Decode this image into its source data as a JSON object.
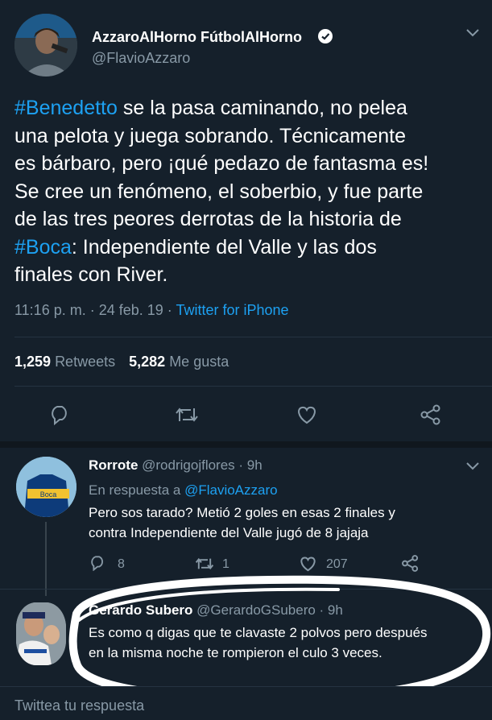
{
  "main_tweet": {
    "display_name": "AzzaroAlHorno FútbolAlHorno",
    "handle": "@FlavioAzzaro",
    "text_lines": [
      [
        {
          "t": "#Benedetto",
          "hl": true
        },
        {
          "t": " se la pasa caminando, no pelea",
          "hl": false
        }
      ],
      [
        {
          "t": "una pelota y juega sobrando. Técnicamente",
          "hl": false
        }
      ],
      [
        {
          "t": "es bárbaro, pero ¡qué pedazo de fantasma es!",
          "hl": false
        }
      ],
      [
        {
          "t": "Se cree un fenómeno, el soberbio, y fue parte",
          "hl": false
        }
      ],
      [
        {
          "t": "de las tres peores derrotas de la historia de",
          "hl": false
        }
      ],
      [
        {
          "t": "#Boca",
          "hl": true
        },
        {
          "t": ": Independiente del Valle y las dos",
          "hl": false
        }
      ],
      [
        {
          "t": "finales con River.",
          "hl": false
        }
      ]
    ],
    "time": "11:16 p. m. · 24 feb. 19 · ",
    "source": "Twitter for iPhone",
    "retweets_count": "1,259",
    "retweets_label": "Retweets",
    "likes_count": "5,282",
    "likes_label": "Me gusta"
  },
  "reply1": {
    "display_name": "Rorrote",
    "meta": "@rodrigojflores · 9h",
    "reply_to_label": "En respuesta a ",
    "reply_to_handle": "@FlavioAzzaro",
    "text_line1": "Pero sos tarado? Metió 2 goles en esas 2 finales y",
    "text_line2": "contra Independiente del Valle jugó de 8 jajaja",
    "replies": "8",
    "retweets": "1",
    "likes": "207"
  },
  "reply2": {
    "display_name": "Gerardo Subero",
    "meta": "@GerardoGSubero · 9h",
    "text_line1": "Es como q digas que te clavaste 2 polvos pero después",
    "text_line2": "en la misma noche te rompieron el culo 3 veces."
  },
  "compose": {
    "placeholder": "Twittea tu respuesta"
  },
  "colors": {
    "background": "#15202b",
    "accent": "#1da1f2",
    "muted": "#8899a6"
  }
}
